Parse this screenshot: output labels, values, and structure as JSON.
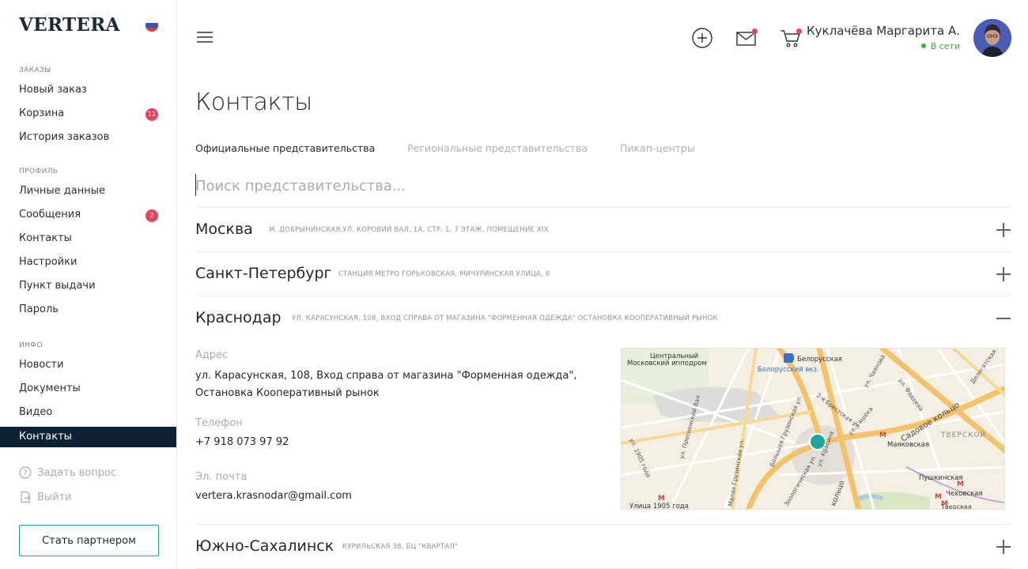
{
  "brand": {
    "logo_text": "VERTERA"
  },
  "sidebar": {
    "sections": {
      "orders": "ЗАКАЗЫ",
      "profile": "ПРОФИЛЬ",
      "info": "ИНФО"
    },
    "items": [
      {
        "label": "Новый заказ"
      },
      {
        "label": "Корзина",
        "badge": "12"
      },
      {
        "label": "История заказов"
      },
      {
        "label": "Личные данные"
      },
      {
        "label": "Сообщения",
        "badge": "2"
      },
      {
        "label": "Контакты"
      },
      {
        "label": "Настройки"
      },
      {
        "label": "Пункт выдачи"
      },
      {
        "label": "Пароль"
      },
      {
        "label": "Новости"
      },
      {
        "label": "Документы"
      },
      {
        "label": "Видео"
      },
      {
        "label": "Контакты",
        "active": true
      }
    ],
    "ask_question": "Задать вопрос",
    "logout": "Выйти",
    "partner_button": "Стать партнером"
  },
  "header": {
    "user_name": "Куклачёва Маргарита А.",
    "user_status": "В сети",
    "icons": [
      "plus-circle-icon",
      "mail-icon",
      "cart-icon"
    ]
  },
  "main": {
    "title": "Контакты",
    "tabs": [
      {
        "label": "Официальные представительства",
        "active": true
      },
      {
        "label": "Региональные представительства"
      },
      {
        "label": "Пикап-центры"
      }
    ],
    "search_placeholder": "Поиск представительства..."
  },
  "offices": [
    {
      "city": "Москва",
      "address": "м. Добрынинская,ул. Коровий Вал, 1А, стр. 1, 7 этаж, помещение XIX",
      "expanded": false
    },
    {
      "city": "Санкт-Петербург",
      "address": "Станция метро Горьковская, Мичуринская улица, 6",
      "expanded": false
    },
    {
      "city": "Краснодар",
      "address": "ул. Карасунская, 108, Вход справа от магазина \"Форменная одежда\" Остановка Кооперативный рынок",
      "expanded": true
    },
    {
      "city": "Южно-Сахалинск",
      "address": "Курильская 38, БЦ \"Квартал\"",
      "expanded": false
    }
  ],
  "details": {
    "address_label": "Адрес",
    "address_line1": "ул. Карасунская, 108, Вход справа от магазина \"Форменная одежда\",",
    "address_line2": "Остановка Кооперативный рынок",
    "phone_label": "Телефон",
    "phone": "+7 918 073 97 92",
    "email_label": "Эл. почта",
    "email": "vertera.krasnodar@gmail.com"
  },
  "map": {
    "labels": {
      "hippodrome_1": "Центральный",
      "hippodrome_2": "Московский ипподром",
      "station": "Белорусский вкз.",
      "metro_belorusskaya": "Белорусская",
      "street_chayanova": "ул. Чаянова",
      "street_fadeeva": "ул. Фадеева",
      "street_delegatskaya": "Делегатская",
      "garden_ring": "Садовое кольцо",
      "district": "ТВЕРСКОЙ",
      "brestskaya": "2-я Брестская ул.",
      "presnensky": "ул. Пресненский Вал",
      "gruzinskaya": "Большая Грузинская ул.",
      "gashka": "ул. Гашека",
      "krasina": "ул. Красина",
      "mayakovskaya": "Маяковская",
      "pushkinskaya": "Пушкинская",
      "chekhovskaya": "Чеховская",
      "tverskaya": "Тверская",
      "street_1905": "ул. 1905 года",
      "metro_1905": "Улица 1905 года",
      "malaya_gruzinskaya": "Малая Грузинская ул.",
      "zoo": "Зоологическая ул.",
      "ring_short": "кольцо"
    },
    "colors": {
      "marker": "#1ba79a",
      "major_road": "#f3c26a",
      "minor_road": "#ffffff",
      "park": "#d8e6c4",
      "water": "#a9c9e6",
      "block": "#efe8d8",
      "metro": "#e33b3b"
    }
  },
  "colors": {
    "sidebar_active": "#0f2234",
    "badge": "#e8435a",
    "online": "#4aa83a",
    "partner_border": "#20a09a"
  }
}
